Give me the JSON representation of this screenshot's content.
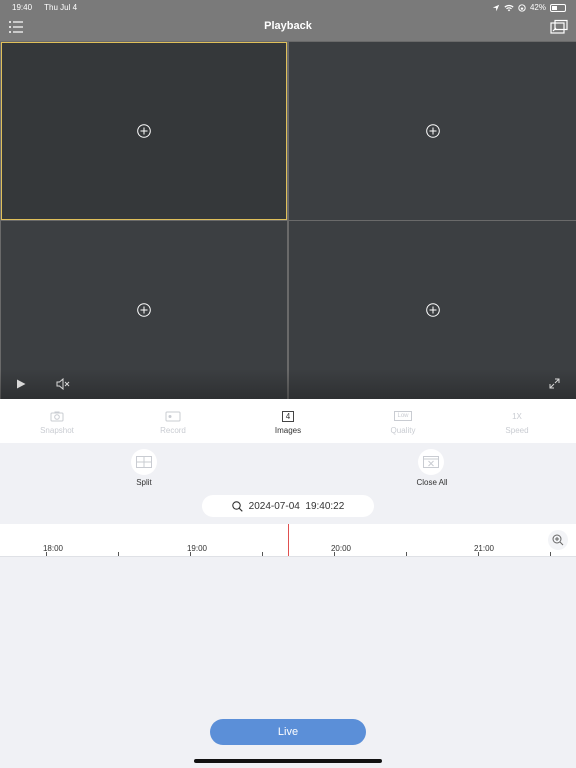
{
  "status_bar": {
    "time": "19:40",
    "date": "Thu Jul 4",
    "battery": "42%",
    "battery_level": 0.42
  },
  "header": {
    "title": "Playback",
    "menu_icon": "menu-icon",
    "cast_icon": "multi-screen-icon"
  },
  "panes": [
    {
      "id": "pane-1",
      "selected": true
    },
    {
      "id": "pane-2",
      "selected": false
    },
    {
      "id": "pane-3",
      "selected": false
    },
    {
      "id": "pane-4",
      "selected": false
    }
  ],
  "toolbar": {
    "snapshot": "Snapshot",
    "record": "Record",
    "images_count": "4",
    "images": "Images",
    "quality_badge": "Low",
    "quality": "Quality",
    "speed_badge": "1X",
    "speed": "Speed"
  },
  "actions": {
    "split": "Split",
    "close_all": "Close All"
  },
  "search": {
    "datetime": "2024-07-04  19:40:22"
  },
  "timeline": {
    "labels": [
      "18:00",
      "19:00",
      "20:00",
      "21:00"
    ]
  },
  "live_button": "Live",
  "colors": {
    "accent": "#5b8fd8",
    "selected_border": "#e0c05a",
    "cursor": "#e05050",
    "header": "#7a7a7a"
  }
}
